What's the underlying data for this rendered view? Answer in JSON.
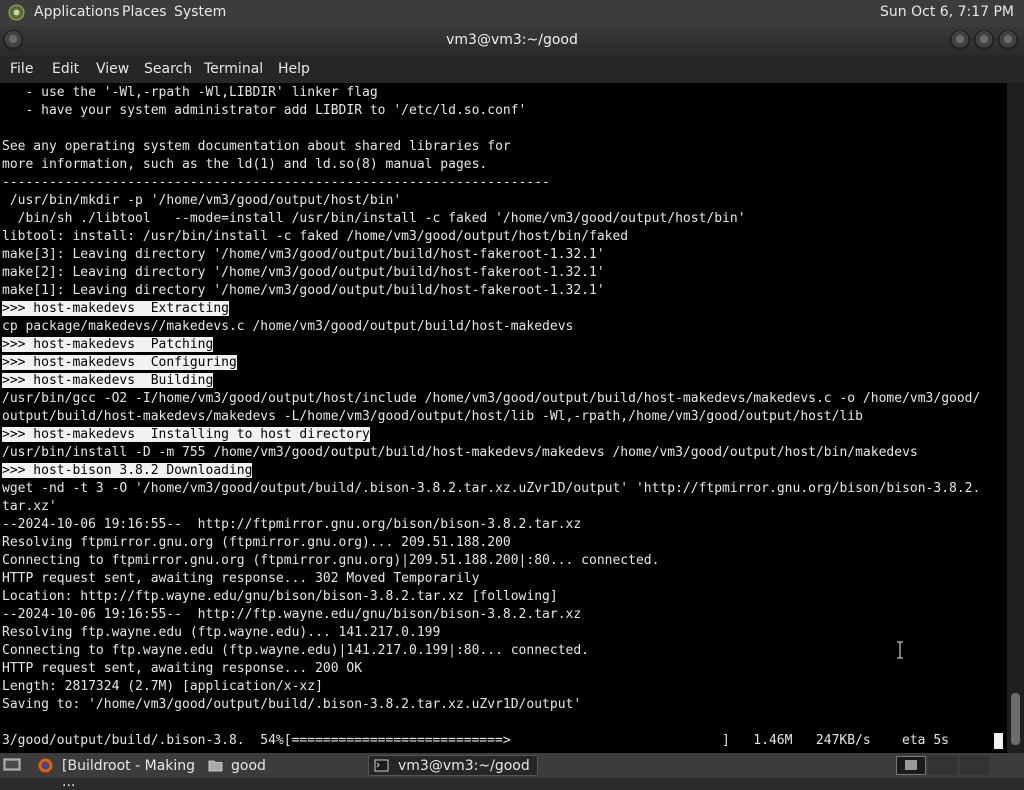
{
  "top_panel": {
    "applications": "Applications",
    "places": "Places",
    "system": "System",
    "clock": "Sun Oct  6,  7:17 PM"
  },
  "window": {
    "title": "vm3@vm3:~/good"
  },
  "menubar": {
    "file": "File",
    "edit": "Edit",
    "view": "View",
    "search": "Search",
    "terminal": "Terminal",
    "help": "Help"
  },
  "terminal": {
    "lines": [
      {
        "text": "   - use the '-Wl,-rpath -Wl,LIBDIR' linker flag",
        "hl": false
      },
      {
        "text": "   - have your system administrator add LIBDIR to '/etc/ld.so.conf'",
        "hl": false
      },
      {
        "text": "",
        "hl": false
      },
      {
        "text": "See any operating system documentation about shared libraries for",
        "hl": false
      },
      {
        "text": "more information, such as the ld(1) and ld.so(8) manual pages.",
        "hl": false
      },
      {
        "text": "----------------------------------------------------------------------",
        "hl": false
      },
      {
        "text": " /usr/bin/mkdir -p '/home/vm3/good/output/host/bin'",
        "hl": false
      },
      {
        "text": "  /bin/sh ./libtool   --mode=install /usr/bin/install -c faked '/home/vm3/good/output/host/bin'",
        "hl": false
      },
      {
        "text": "libtool: install: /usr/bin/install -c faked /home/vm3/good/output/host/bin/faked",
        "hl": false
      },
      {
        "text": "make[3]: Leaving directory '/home/vm3/good/output/build/host-fakeroot-1.32.1'",
        "hl": false
      },
      {
        "text": "make[2]: Leaving directory '/home/vm3/good/output/build/host-fakeroot-1.32.1'",
        "hl": false
      },
      {
        "text": "make[1]: Leaving directory '/home/vm3/good/output/build/host-fakeroot-1.32.1'",
        "hl": false
      },
      {
        "text": ">>> host-makedevs  Extracting",
        "hl": true
      },
      {
        "text": "cp package/makedevs//makedevs.c /home/vm3/good/output/build/host-makedevs",
        "hl": false
      },
      {
        "text": ">>> host-makedevs  Patching",
        "hl": true
      },
      {
        "text": ">>> host-makedevs  Configuring",
        "hl": true
      },
      {
        "text": ">>> host-makedevs  Building",
        "hl": true
      },
      {
        "text": "/usr/bin/gcc -O2 -I/home/vm3/good/output/host/include /home/vm3/good/output/build/host-makedevs/makedevs.c -o /home/vm3/good/",
        "hl": false
      },
      {
        "text": "output/build/host-makedevs/makedevs -L/home/vm3/good/output/host/lib -Wl,-rpath,/home/vm3/good/output/host/lib",
        "hl": false
      },
      {
        "text": ">>> host-makedevs  Installing to host directory",
        "hl": true
      },
      {
        "text": "/usr/bin/install -D -m 755 /home/vm3/good/output/build/host-makedevs/makedevs /home/vm3/good/output/host/bin/makedevs",
        "hl": false
      },
      {
        "text": ">>> host-bison 3.8.2 Downloading",
        "hl": true
      },
      {
        "text": "wget -nd -t 3 -O '/home/vm3/good/output/build/.bison-3.8.2.tar.xz.uZvr1D/output' 'http://ftpmirror.gnu.org/bison/bison-3.8.2.",
        "hl": false
      },
      {
        "text": "tar.xz'",
        "hl": false
      },
      {
        "text": "--2024-10-06 19:16:55--  http://ftpmirror.gnu.org/bison/bison-3.8.2.tar.xz",
        "hl": false
      },
      {
        "text": "Resolving ftpmirror.gnu.org (ftpmirror.gnu.org)... 209.51.188.200",
        "hl": false
      },
      {
        "text": "Connecting to ftpmirror.gnu.org (ftpmirror.gnu.org)|209.51.188.200|:80... connected.",
        "hl": false
      },
      {
        "text": "HTTP request sent, awaiting response... 302 Moved Temporarily",
        "hl": false
      },
      {
        "text": "Location: http://ftp.wayne.edu/gnu/bison/bison-3.8.2.tar.xz [following]",
        "hl": false
      },
      {
        "text": "--2024-10-06 19:16:55--  http://ftp.wayne.edu/gnu/bison/bison-3.8.2.tar.xz",
        "hl": false
      },
      {
        "text": "Resolving ftp.wayne.edu (ftp.wayne.edu)... 141.217.0.199",
        "hl": false
      },
      {
        "text": "Connecting to ftp.wayne.edu (ftp.wayne.edu)|141.217.0.199|:80... connected.",
        "hl": false
      },
      {
        "text": "HTTP request sent, awaiting response... 200 OK",
        "hl": false
      },
      {
        "text": "Length: 2817324 (2.7M) [application/x-xz]",
        "hl": false
      },
      {
        "text": "Saving to: '/home/vm3/good/output/build/.bison-3.8.2.tar.xz.uZvr1D/output'",
        "hl": false
      }
    ],
    "progress_line": "3/good/output/build/.bison-3.8.  54%[===========================>",
    "progress_tail": "]   1.46M   247KB/s    eta 5s"
  },
  "taskbar": {
    "task_browser": "[Buildroot - Making ...",
    "task_folder": "good",
    "task_terminal": "vm3@vm3:~/good"
  }
}
